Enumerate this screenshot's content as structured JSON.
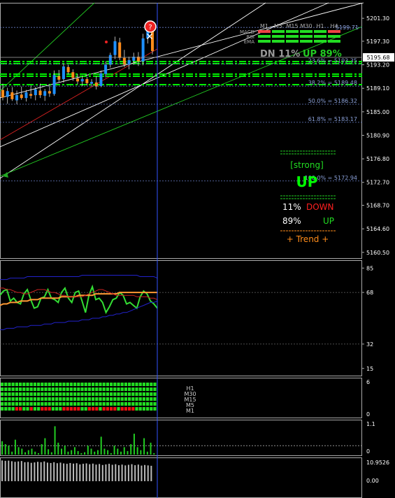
{
  "colors": {
    "background": "#000000",
    "up_candle": "#1e90ff",
    "down_candle": "#ff8c1a",
    "channel": "#ffffff",
    "green_line": "#22cc22",
    "red_line": "#dd2222",
    "fib": "#6a7fc8",
    "dash_level": "#00ee00",
    "strong": "#00ff00",
    "down": "#ff2020",
    "up": "#22dd22",
    "trend": "#ff8c1a",
    "blue_band": "#2222cc",
    "rsi_green": "#33dd33",
    "rsi_orange": "#ff9933",
    "rsi_red": "#cc2222",
    "pane_border": "#aaaaaa",
    "vline": "#3355ff"
  },
  "main": {
    "y_axis": [
      "5201.30",
      "5197.30",
      "5193.20",
      "5189.10",
      "5185.00",
      "5180.90",
      "5176.80",
      "5172.70",
      "5168.70",
      "5164.60",
      "5160.50"
    ],
    "current_price": "5195.68",
    "fib_levels": [
      {
        "label": "23.6% = 5193.35",
        "price": 5193.35
      },
      {
        "label": "38.2% = 5189.48",
        "price": 5189.48
      },
      {
        "label": "50.0% = 5186.32",
        "price": 5186.32
      },
      {
        "label": "61.8% = 5183.17",
        "price": 5183.17
      },
      {
        "label": "100.0% = 5172.94",
        "price": 5172.94
      }
    ],
    "top_level": {
      "label": "5199.71",
      "price": 5199.71
    },
    "timeframes": [
      "M1",
      "M5",
      "M15",
      "M30",
      "H1",
      "H4"
    ],
    "indicator_rows": [
      "MACD",
      "RSI",
      "EMA"
    ],
    "summary": {
      "dn_label": "DN 11%",
      "up_label": "UP 89%"
    },
    "signal": {
      "strong": "[strong]",
      "direction": "UP",
      "down_pct": "11%",
      "down_label": "DOWN",
      "up_pct": "89%",
      "up_label": "UP",
      "trend": "+   Trend   +"
    }
  },
  "rsi": {
    "y_axis": [
      "85",
      "68",
      "32",
      "15"
    ]
  },
  "strength": {
    "y_axis": [
      "6",
      "0"
    ],
    "labels": [
      "H1",
      "M30",
      "M15",
      "M5",
      "M1"
    ]
  },
  "volume": {
    "y_axis": [
      "1.1",
      "0"
    ]
  },
  "atr": {
    "y_axis": [
      "10.9526",
      "0.00"
    ]
  },
  "chart_data": [
    {
      "type": "candlestick",
      "title": "",
      "ylim": [
        5159.5,
        5204.0
      ],
      "candles": [
        {
          "o": 5188.8,
          "h": 5189.9,
          "l": 5187.0,
          "c": 5187.5
        },
        {
          "o": 5187.6,
          "h": 5189.2,
          "l": 5186.4,
          "c": 5188.6
        },
        {
          "o": 5188.4,
          "h": 5189.3,
          "l": 5186.9,
          "c": 5187.2
        },
        {
          "o": 5187.0,
          "h": 5188.7,
          "l": 5186.3,
          "c": 5187.9
        },
        {
          "o": 5188.0,
          "h": 5189.4,
          "l": 5187.1,
          "c": 5187.4
        },
        {
          "o": 5187.4,
          "h": 5188.8,
          "l": 5186.8,
          "c": 5188.4
        },
        {
          "o": 5188.1,
          "h": 5189.6,
          "l": 5187.3,
          "c": 5187.8
        },
        {
          "o": 5187.9,
          "h": 5189.3,
          "l": 5187.0,
          "c": 5188.9
        },
        {
          "o": 5188.7,
          "h": 5189.9,
          "l": 5187.4,
          "c": 5187.9
        },
        {
          "o": 5187.8,
          "h": 5189.0,
          "l": 5186.9,
          "c": 5188.6
        },
        {
          "o": 5188.6,
          "h": 5189.8,
          "l": 5187.6,
          "c": 5188.2
        },
        {
          "o": 5188.1,
          "h": 5192.2,
          "l": 5187.8,
          "c": 5191.4
        },
        {
          "o": 5191.2,
          "h": 5192.3,
          "l": 5190.2,
          "c": 5190.6
        },
        {
          "o": 5190.7,
          "h": 5193.4,
          "l": 5190.1,
          "c": 5192.9
        },
        {
          "o": 5192.8,
          "h": 5193.2,
          "l": 5191.5,
          "c": 5191.9
        },
        {
          "o": 5191.9,
          "h": 5192.4,
          "l": 5190.4,
          "c": 5190.9
        },
        {
          "o": 5190.8,
          "h": 5191.6,
          "l": 5189.8,
          "c": 5190.3
        },
        {
          "o": 5190.3,
          "h": 5191.3,
          "l": 5189.5,
          "c": 5190.7
        },
        {
          "o": 5190.7,
          "h": 5191.1,
          "l": 5189.6,
          "c": 5190.0
        },
        {
          "o": 5189.9,
          "h": 5190.7,
          "l": 5189.4,
          "c": 5190.2
        },
        {
          "o": 5190.1,
          "h": 5191.2,
          "l": 5188.9,
          "c": 5189.4
        },
        {
          "o": 5189.5,
          "h": 5192.2,
          "l": 5189.3,
          "c": 5191.7
        },
        {
          "o": 5191.6,
          "h": 5193.8,
          "l": 5191.0,
          "c": 5193.2
        },
        {
          "o": 5193.2,
          "h": 5195.3,
          "l": 5192.7,
          "c": 5194.9
        },
        {
          "o": 5194.9,
          "h": 5198.1,
          "l": 5194.2,
          "c": 5197.3
        },
        {
          "o": 5197.1,
          "h": 5197.9,
          "l": 5194.0,
          "c": 5194.4
        },
        {
          "o": 5194.4,
          "h": 5195.8,
          "l": 5192.8,
          "c": 5193.2
        },
        {
          "o": 5193.2,
          "h": 5194.6,
          "l": 5192.4,
          "c": 5194.0
        },
        {
          "o": 5193.9,
          "h": 5195.3,
          "l": 5193.2,
          "c": 5194.6
        },
        {
          "o": 5194.6,
          "h": 5195.4,
          "l": 5193.0,
          "c": 5193.8
        },
        {
          "o": 5193.8,
          "h": 5198.6,
          "l": 5193.1,
          "c": 5197.8
        },
        {
          "o": 5197.8,
          "h": 5200.9,
          "l": 5196.9,
          "c": 5199.7
        },
        {
          "o": 5199.6,
          "h": 5199.9,
          "l": 5195.0,
          "c": 5195.6
        }
      ]
    },
    {
      "type": "line",
      "title": "",
      "ylim": [
        10,
        90
      ],
      "series": [
        {
          "color": "green",
          "values": [
            66,
            69,
            70,
            62,
            64,
            61,
            60,
            67,
            70,
            63,
            57,
            58,
            64,
            65,
            70,
            64,
            63,
            61,
            68,
            71,
            64,
            61,
            68,
            69,
            62,
            54,
            66,
            72,
            63,
            64,
            61,
            54,
            58,
            63,
            64,
            68,
            66,
            60,
            61,
            59,
            57,
            65,
            69,
            67,
            62,
            60,
            57
          ]
        },
        {
          "color": "orange",
          "values": [
            59,
            60,
            60,
            61,
            61,
            61,
            62,
            62,
            62,
            63,
            63,
            63,
            64,
            64,
            64,
            64,
            64,
            64,
            65,
            65,
            65,
            65,
            65,
            66,
            66,
            66,
            66,
            66,
            67,
            67,
            67,
            67,
            67,
            67,
            67,
            68,
            68,
            68,
            68,
            68,
            68,
            68,
            68,
            68,
            68,
            68,
            68
          ]
        },
        {
          "color": "red",
          "values": [
            71,
            71,
            70,
            70,
            69,
            68,
            68,
            67,
            67,
            68,
            69,
            70,
            70,
            70,
            69,
            68,
            68,
            67,
            66,
            66,
            65,
            65,
            65,
            65,
            65,
            66,
            67,
            68,
            69,
            70,
            70,
            69,
            68,
            67,
            66,
            66,
            66,
            66,
            66,
            66,
            65,
            65,
            65,
            65,
            64,
            64,
            63
          ]
        },
        {
          "color": "blue_upper",
          "values": [
            77,
            77,
            77,
            78,
            78,
            78,
            78,
            78,
            79,
            79,
            79,
            79,
            79,
            79,
            79,
            79,
            79,
            79,
            79,
            79,
            79,
            79,
            79,
            79,
            80,
            80,
            80,
            80,
            80,
            80,
            80,
            80,
            80,
            80,
            80,
            80,
            80,
            80,
            80,
            80,
            80,
            79,
            79,
            79,
            79,
            79,
            78
          ]
        },
        {
          "color": "blue_lower",
          "values": [
            42,
            42,
            43,
            43,
            43,
            44,
            44,
            44,
            44,
            45,
            45,
            45,
            45,
            46,
            46,
            46,
            47,
            47,
            47,
            47,
            48,
            48,
            48,
            48,
            49,
            49,
            49,
            50,
            50,
            50,
            51,
            51,
            52,
            52,
            53,
            53,
            54,
            54,
            55,
            56,
            57,
            58,
            59,
            60,
            61,
            61,
            62
          ]
        }
      ]
    },
    {
      "type": "heatmap",
      "title": "",
      "rows": [
        "H1",
        "M30",
        "M15",
        "M5",
        "M1"
      ],
      "bottom_row_red_columns": [
        4,
        5,
        8,
        11,
        12,
        13,
        17,
        18,
        19,
        20,
        21,
        24,
        25,
        26,
        28,
        29,
        30,
        31,
        33,
        34,
        35,
        36
      ]
    },
    {
      "type": "bar",
      "title": "",
      "ylim": [
        0,
        1.1
      ],
      "values": [
        0.45,
        0.35,
        0.3,
        0.1,
        0.5,
        0.25,
        0.2,
        0.08,
        0.15,
        0.2,
        0.1,
        0.05,
        0.35,
        0.55,
        0.18,
        0.08,
        0.95,
        0.4,
        0.2,
        0.3,
        0.1,
        0.15,
        0.25,
        0.12,
        0.05,
        0.08,
        0.3,
        0.2,
        0.1,
        0.15,
        0.6,
        0.2,
        0.15,
        0.05,
        0.3,
        0.2,
        0.1,
        0.25,
        0.12,
        0.35,
        0.7,
        0.25,
        0.15,
        0.55,
        0.1,
        0.4,
        0.05
      ]
    },
    {
      "type": "bar",
      "title": "",
      "ylim": [
        0,
        10.9526
      ],
      "values": [
        10.5,
        10.3,
        10.4,
        10.1,
        9.8,
        10.0,
        10.2,
        9.6,
        9.7,
        9.3,
        9.5,
        9.8,
        9.6,
        10.0,
        9.4,
        9.2,
        9.6,
        9.1,
        9.4,
        9.0,
        8.8,
        9.2,
        8.9,
        9.1,
        8.5,
        8.8,
        9.0,
        8.6,
        8.9,
        8.4,
        8.7,
        8.2,
        8.5,
        8.8,
        8.3,
        8.6,
        8.1,
        8.4,
        8.0,
        8.3,
        8.6,
        8.1,
        8.4,
        7.9,
        8.2,
        8.0,
        7.8
      ]
    }
  ]
}
